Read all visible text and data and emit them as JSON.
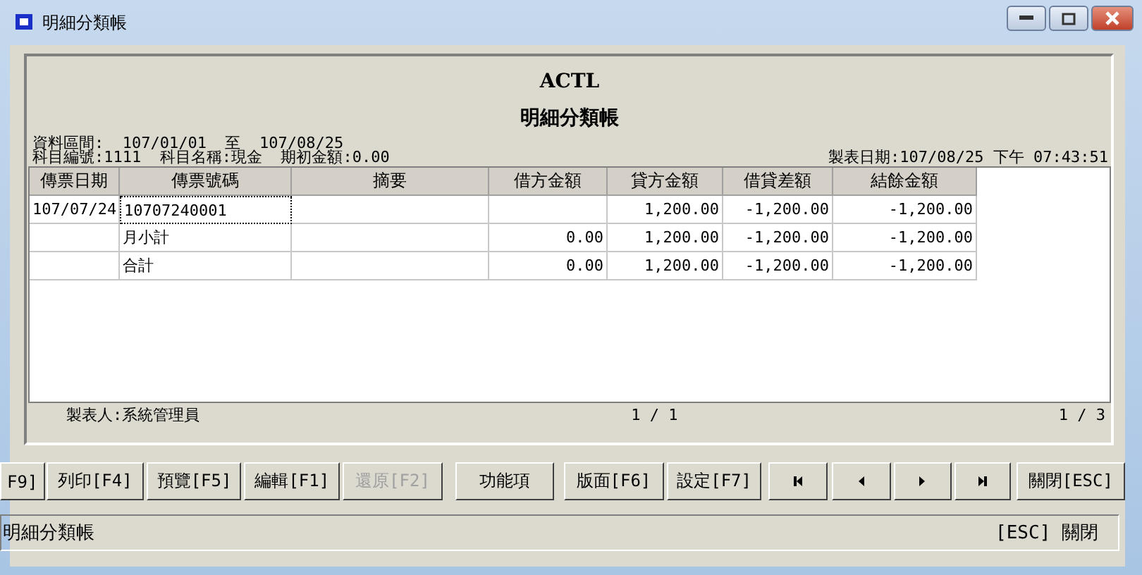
{
  "window": {
    "title": "明細分類帳"
  },
  "report": {
    "company": "ACTL",
    "title": "明細分類帳",
    "period": "資料區間:  107/01/01  至  107/08/25",
    "account": "科目編號:1111  科目名稱:現金  期初金額:0.00",
    "print_date": "製表日期:107/08/25 下午 07:43:51"
  },
  "table": {
    "columns": [
      "傳票日期",
      "傳票號碼",
      "摘要",
      "借方金額",
      "貸方金額",
      "借貸差額",
      "結餘金額"
    ],
    "rows": [
      {
        "cells": [
          {
            "text": "107/07/24",
            "selected": false
          },
          {
            "text": "10707240001",
            "selected": true
          },
          {
            "text": "",
            "selected": false
          },
          {
            "text": "",
            "selected": false
          },
          {
            "text": "1,200.00",
            "selected": false
          },
          {
            "text": "-1,200.00",
            "selected": false
          },
          {
            "text": "-1,200.00",
            "selected": false
          }
        ]
      },
      {
        "cells": [
          {
            "text": "",
            "selected": false
          },
          {
            "text": "月小計",
            "selected": false
          },
          {
            "text": "",
            "selected": false
          },
          {
            "text": "0.00",
            "selected": false
          },
          {
            "text": "1,200.00",
            "selected": false
          },
          {
            "text": "-1,200.00",
            "selected": false
          },
          {
            "text": "-1,200.00",
            "selected": false
          }
        ]
      },
      {
        "cells": [
          {
            "text": "",
            "selected": false
          },
          {
            "text": "合計",
            "selected": false
          },
          {
            "text": "",
            "selected": false
          },
          {
            "text": "0.00",
            "selected": false
          },
          {
            "text": "1,200.00",
            "selected": false
          },
          {
            "text": "-1,200.00",
            "selected": false
          },
          {
            "text": "-1,200.00",
            "selected": false
          }
        ]
      }
    ]
  },
  "footer": {
    "maker": "製表人:系統管理員",
    "page": "1 / 1",
    "total_pages": "1 / 3"
  },
  "buttons": [
    {
      "kind": "text",
      "label": "F9]",
      "disabled": false
    },
    {
      "kind": "text",
      "label": "列印[F4]",
      "disabled": false
    },
    {
      "kind": "text",
      "label": "預覽[F5]",
      "disabled": false
    },
    {
      "kind": "text",
      "label": "編輯[F1]",
      "disabled": false
    },
    {
      "kind": "text",
      "label": "還原[F2]",
      "disabled": true
    },
    {
      "kind": "text",
      "label": "功能項",
      "disabled": false
    },
    {
      "kind": "text",
      "label": "版面[F6]",
      "disabled": false
    },
    {
      "kind": "text",
      "label": "設定[F7]",
      "disabled": false
    },
    {
      "kind": "first"
    },
    {
      "kind": "prev"
    },
    {
      "kind": "next"
    },
    {
      "kind": "last"
    },
    {
      "kind": "text",
      "label": "關閉[ESC]",
      "disabled": false
    }
  ],
  "status_bar": {
    "left": "明細分類帳",
    "right": "[ESC] 關閉"
  }
}
